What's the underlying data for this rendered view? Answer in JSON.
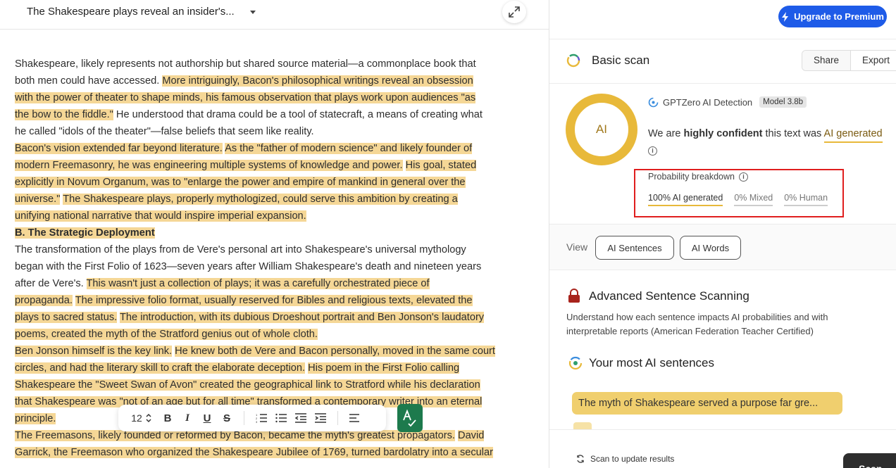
{
  "document": {
    "title": "The Shakespeare plays reveal an insider's...",
    "lines": [
      [
        {
          "t": "Shakespeare, likely represents not authorship but shared source material—a commonplace book that",
          "h": false
        }
      ],
      [
        {
          "t": "both men could have accessed. ",
          "h": false
        },
        {
          "t": "More intriguingly, Bacon's philosophical writings reveal an obsession",
          "h": true
        }
      ],
      [
        {
          "t": "with the power of theater to shape minds, his famous observation that plays work upon audiences \"as",
          "h": true
        }
      ],
      [
        {
          "t": "the bow to the fiddle.\"",
          "h": true
        },
        {
          "t": " He understood that drama could be a tool of statecraft, a means of creating what",
          "h": false
        }
      ],
      [
        {
          "t": "he called \"idols of the theater\"—false beliefs that seem like reality.",
          "h": false
        }
      ],
      [
        {
          "t": "Bacon's vision extended far beyond literature.",
          "h": true
        },
        {
          "t": " ",
          "h": false
        },
        {
          "t": "As the \"father of modern science\" and likely founder of",
          "h": true
        }
      ],
      [
        {
          "t": "modern Freemasonry, he was engineering multiple systems of knowledge and power.",
          "h": true
        },
        {
          "t": " ",
          "h": false
        },
        {
          "t": "His goal, stated",
          "h": true
        }
      ],
      [
        {
          "t": "explicitly in Novum Organum, was to \"enlarge the power and empire of mankind in general over the",
          "h": true
        }
      ],
      [
        {
          "t": "universe.\"",
          "h": true
        },
        {
          "t": " ",
          "h": false
        },
        {
          "t": "The Shakespeare plays, properly mythologized, could serve this ambition by creating a",
          "h": true
        }
      ],
      [
        {
          "t": "unifying national narrative that would inspire imperial expansion.",
          "h": true
        }
      ],
      [
        {
          "t": "B. The Strategic Deployment",
          "h": true,
          "b": true
        }
      ],
      [
        {
          "t": "The transformation of the plays from de Vere's personal art into Shakespeare's universal mythology",
          "h": false
        }
      ],
      [
        {
          "t": "began with the First Folio of 1623—seven years after William Shakespeare's death and nineteen years",
          "h": false
        }
      ],
      [
        {
          "t": "after de Vere's. ",
          "h": false
        },
        {
          "t": "This wasn't just a collection of plays; it was a carefully orchestrated piece of",
          "h": true
        }
      ],
      [
        {
          "t": "propaganda.",
          "h": true
        },
        {
          "t": " ",
          "h": false
        },
        {
          "t": "The impressive folio format, usually reserved for Bibles and religious texts, elevated the",
          "h": true
        }
      ],
      [
        {
          "t": "plays to sacred status.",
          "h": true
        },
        {
          "t": " ",
          "h": false
        },
        {
          "t": "The introduction, with its dubious Droeshout portrait and Ben Jonson's laudatory",
          "h": true
        }
      ],
      [
        {
          "t": "poems, created the myth of the Stratford genius out of whole cloth.",
          "h": true
        }
      ],
      [
        {
          "t": "Ben Jonson himself is the key link.",
          "h": true
        },
        {
          "t": " ",
          "h": false
        },
        {
          "t": "He knew both de Vere and Bacon personally, moved in the same court",
          "h": true
        }
      ],
      [
        {
          "t": "circles, and had the literary skill to craft the elaborate deception.",
          "h": true
        },
        {
          "t": " ",
          "h": false
        },
        {
          "t": "His poem in the First Folio calling",
          "h": true
        }
      ],
      [
        {
          "t": "Shakespeare the \"Sweet Swan of Avon\" created the geographical link to Stratford while his declaration",
          "h": true
        }
      ],
      [
        {
          "t": "that Shakespeare was \"not of an age but for all time\" transformed a contemporary writer into an eternal",
          "h": true
        }
      ],
      [
        {
          "t": "principle.",
          "h": true
        }
      ],
      [
        {
          "t": "The Freemasons, likely founded or reformed by Bacon, became the myth's greatest propagators.",
          "h": true
        },
        {
          "t": " ",
          "h": false
        },
        {
          "t": "David",
          "h": true
        }
      ],
      [
        {
          "t": "Garrick, the Freemason who organized the Shakespeare Jubilee of 1769, turned bardolatry into a secular",
          "h": true
        }
      ]
    ]
  },
  "toolbar": {
    "font_size": "12",
    "bold": "B",
    "italic": "I",
    "underline": "U",
    "strike": "S"
  },
  "panel": {
    "upgrade_label": "Upgrade to Premium",
    "scan_title": "Basic scan",
    "share_label": "Share",
    "export_label": "Export",
    "ring_label": "AI",
    "detector_label": "GPTZero AI Detection",
    "model_badge": "Model 3.8b",
    "confidence_pre": "We are ",
    "confidence_bold": "highly confident",
    "confidence_mid": " this text was ",
    "confidence_result": "AI generated",
    "prob_title": "Probability breakdown",
    "prob_ai": "100% AI generated",
    "prob_mixed": "0% Mixed",
    "prob_human": "0% Human",
    "view_label": "View",
    "ai_sentences_btn": "AI Sentences",
    "ai_words_btn": "AI Words",
    "advanced_title": "Advanced Sentence Scanning",
    "advanced_desc": "Understand how each sentence impacts AI probabilities and with interpretable reports (American Federation Teacher Certified)",
    "most_ai_title": "Your most AI sentences",
    "top_sentence": "The myth of Shakespeare served a purpose far gre...",
    "update_hint": "Scan to update results",
    "scan_btn": "Scan"
  },
  "colors": {
    "highlight": "#f5d796",
    "ring": "#e8b93a",
    "premium": "#1e5be8",
    "grammar": "#1d7a4d",
    "callout": "#e01e1e"
  }
}
